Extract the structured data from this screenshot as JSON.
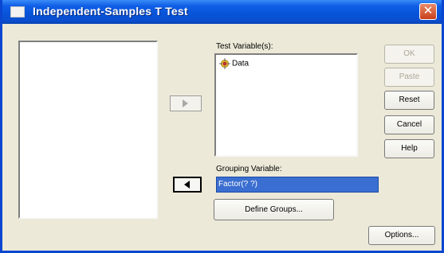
{
  "window": {
    "title": "Independent-Samples T Test",
    "close_symbol": "✕"
  },
  "lists": {
    "source_items": [],
    "test_label": "Test Variable(s):",
    "test_items": [
      {
        "label": "Data",
        "icon": "scale-variable-icon"
      }
    ]
  },
  "grouping": {
    "label": "Grouping Variable:",
    "value": "Factor(? ?)"
  },
  "buttons": {
    "ok": "OK",
    "paste": "Paste",
    "reset": "Reset",
    "cancel": "Cancel",
    "help": "Help",
    "define_groups": "Define Groups...",
    "options": "Options..."
  }
}
